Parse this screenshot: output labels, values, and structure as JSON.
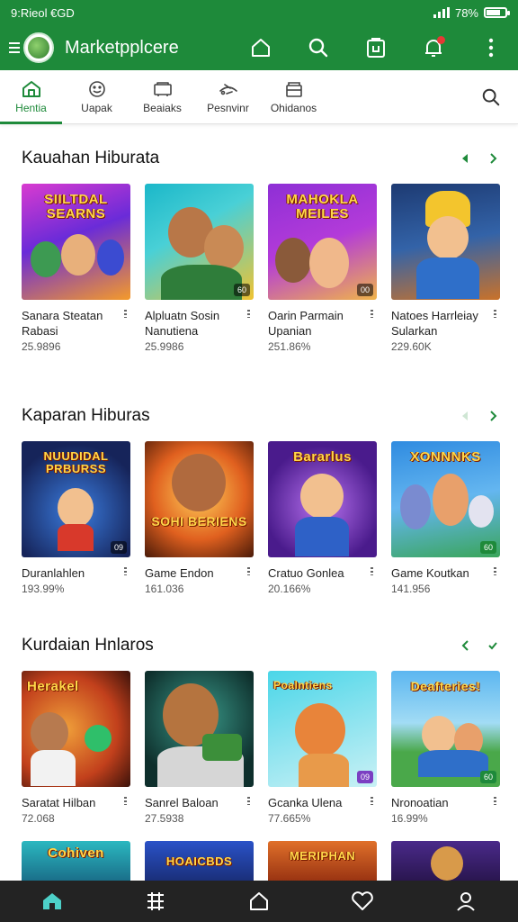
{
  "status_bar": {
    "time": "9:Rieol €GD",
    "battery_text": "78%",
    "battery_level": 0.78
  },
  "app_bar": {
    "title": "Marketpplcere"
  },
  "tabs": [
    {
      "label": "Hentia",
      "icon": "home-icon",
      "active": true
    },
    {
      "label": "Uapak",
      "icon": "smiley-icon",
      "active": false
    },
    {
      "label": "Beaiaks",
      "icon": "cart-icon",
      "active": false
    },
    {
      "label": "Pesnvinr",
      "icon": "joystick-icon",
      "active": false
    },
    {
      "label": "Ohidanos",
      "icon": "store-icon",
      "active": false
    }
  ],
  "sections": [
    {
      "title": "Kauahan Hiburata",
      "cards": [
        {
          "art_title": "SIILTDAL SEARNS",
          "name": "Sanara Steatan Rabasi",
          "meta": "25.9896",
          "badge": ""
        },
        {
          "art_title": "",
          "name": "Alpluatn Sosin Nanutiena",
          "meta": "25.9986",
          "badge": "60"
        },
        {
          "art_title": "MAHOKLA MEILES",
          "name": "Oarin Parmain Upanian",
          "meta": "251.86%",
          "badge": "00"
        },
        {
          "art_title": "",
          "name": "Natoes Harrleiay Sularkan",
          "meta": "229.60K",
          "badge": ""
        }
      ]
    },
    {
      "title": "Kaparan Hiburas",
      "cards": [
        {
          "art_title": "NUUDIDAL PRBURSS",
          "name": "Duranlahlen",
          "meta": "193.99%",
          "badge": "09"
        },
        {
          "art_title": "SOHI BERIENS",
          "name": "Game Endon",
          "meta": "161.036",
          "badge": ""
        },
        {
          "art_title": "Bararlus",
          "name": "Cratuo Gonlea",
          "meta": "20.166%",
          "badge": ""
        },
        {
          "art_title": "XONNNKS",
          "name": "Game Koutkan",
          "meta": "141.956",
          "badge": "60"
        }
      ]
    },
    {
      "title": "Kurdaian Hnlaros",
      "cards": [
        {
          "art_title": "Herakel",
          "name": "Saratat Hilban",
          "meta": "72.068",
          "badge": ""
        },
        {
          "art_title": "",
          "name": "Sanrel Baloan",
          "meta": "27.5938",
          "badge": ""
        },
        {
          "art_title": "Poalntiens",
          "name": "Gcanka Ulena",
          "meta": "77.665%",
          "badge": "09"
        },
        {
          "art_title": "Deafteries!",
          "name": "Nronoatian",
          "meta": "16.99%",
          "badge": "60"
        }
      ]
    }
  ],
  "peek_cards": [
    {
      "art_title": "Cohiven"
    },
    {
      "art_title": "HOAICBDS"
    },
    {
      "art_title": "MERIPHAN"
    },
    {
      "art_title": ""
    }
  ],
  "bottom_nav": [
    {
      "icon": "home-icon",
      "active": true
    },
    {
      "icon": "grid-icon",
      "active": false
    },
    {
      "icon": "house-outline-icon",
      "active": false
    },
    {
      "icon": "heart-icon",
      "active": false
    },
    {
      "icon": "profile-icon",
      "active": false
    }
  ],
  "colors": {
    "primary": "#1e8a3a",
    "accent": "#4dd0c8",
    "nav_bg": "#232323"
  }
}
